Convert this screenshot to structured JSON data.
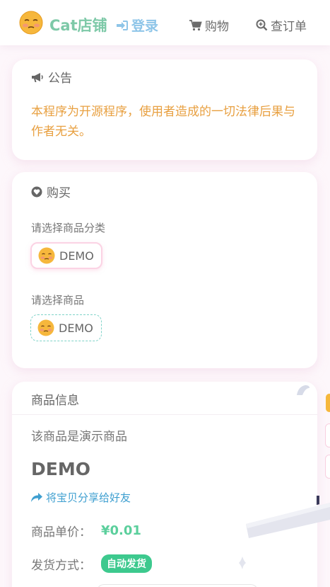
{
  "header": {
    "brand": "Cat店铺",
    "login": "登录",
    "nav": [
      {
        "label": "购物",
        "icon": "cart-icon"
      },
      {
        "label": "查订单",
        "icon": "search-icon"
      }
    ]
  },
  "notice": {
    "title": "公告",
    "text": "本程序为开源程序，使用者造成的一切法律后果与作者无关。"
  },
  "buy": {
    "title": "购买",
    "category_label": "请选择商品分类",
    "category_chip": "DEMO",
    "product_label": "请选择商品",
    "product_chip": "DEMO"
  },
  "info": {
    "title": "商品信息",
    "description": "该商品是演示商品",
    "name": "DEMO",
    "share": "将宝贝分享给好友",
    "price_label": "商品单价：",
    "price": "¥0.01",
    "delivery_label": "发货方式：",
    "delivery_badge": "自动发货"
  },
  "colors": {
    "brand": "#7ec9a8",
    "login": "#8ec5e8",
    "notice_text": "#e8a041",
    "price": "#5bcf9c",
    "badge": "#3dc98e",
    "share": "#3e9fd0"
  }
}
